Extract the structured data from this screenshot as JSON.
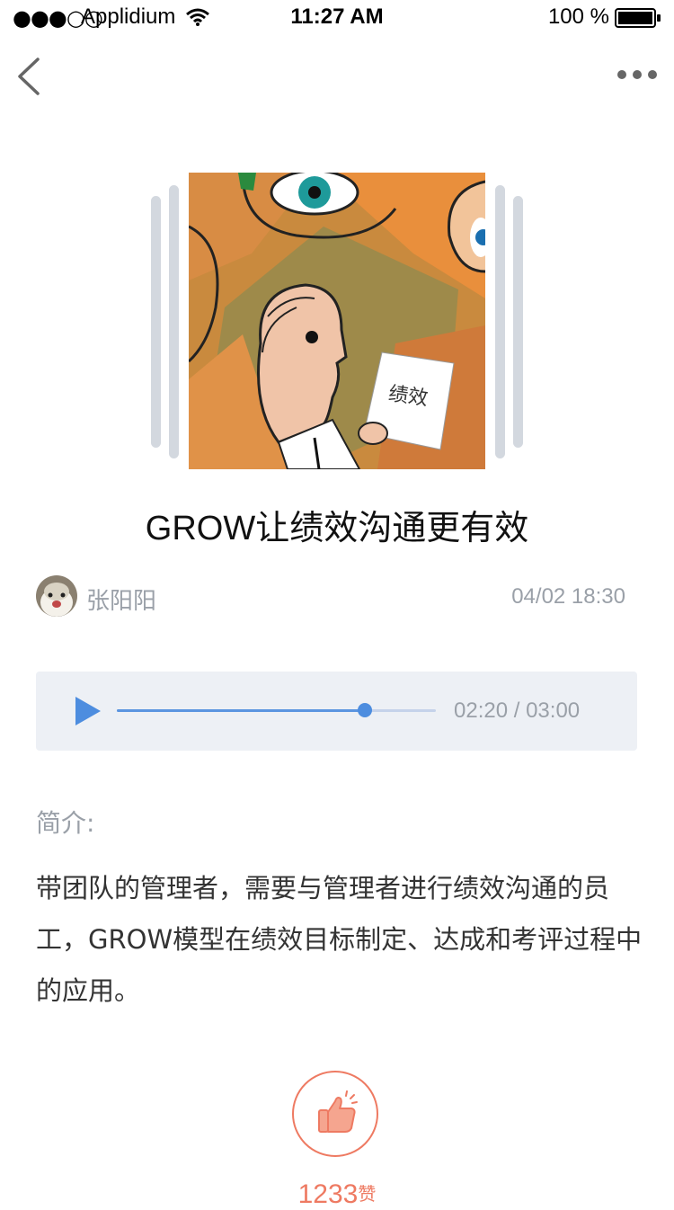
{
  "status_bar": {
    "signal": "●●●○○",
    "carrier": "Applidium",
    "time": "11:27 AM",
    "battery_pct": "100 %"
  },
  "nav": {
    "back_icon": "chevron-left-icon",
    "more_icon": "more-dots-icon"
  },
  "cover": {
    "caption": "绩效"
  },
  "article": {
    "title": "GROW让绩效沟通更有效",
    "author": "张阳阳",
    "publish_time": "04/02 18:30"
  },
  "audio": {
    "current": "02:20",
    "separator": " / ",
    "duration": "03:00",
    "progress": 0.778,
    "colors": {
      "fill": "#5b95e0",
      "track": "#c5d2ea",
      "background": "#edf0f5"
    }
  },
  "intro": {
    "label": "简介:",
    "text": "带团队的管理者，需要与管理者进行绩效沟通的员工，GROW模型在绩效目标制定、达成和考评过程中的应用。"
  },
  "like": {
    "count": "1233",
    "suffix": "赞",
    "color": "#ee7a62"
  }
}
